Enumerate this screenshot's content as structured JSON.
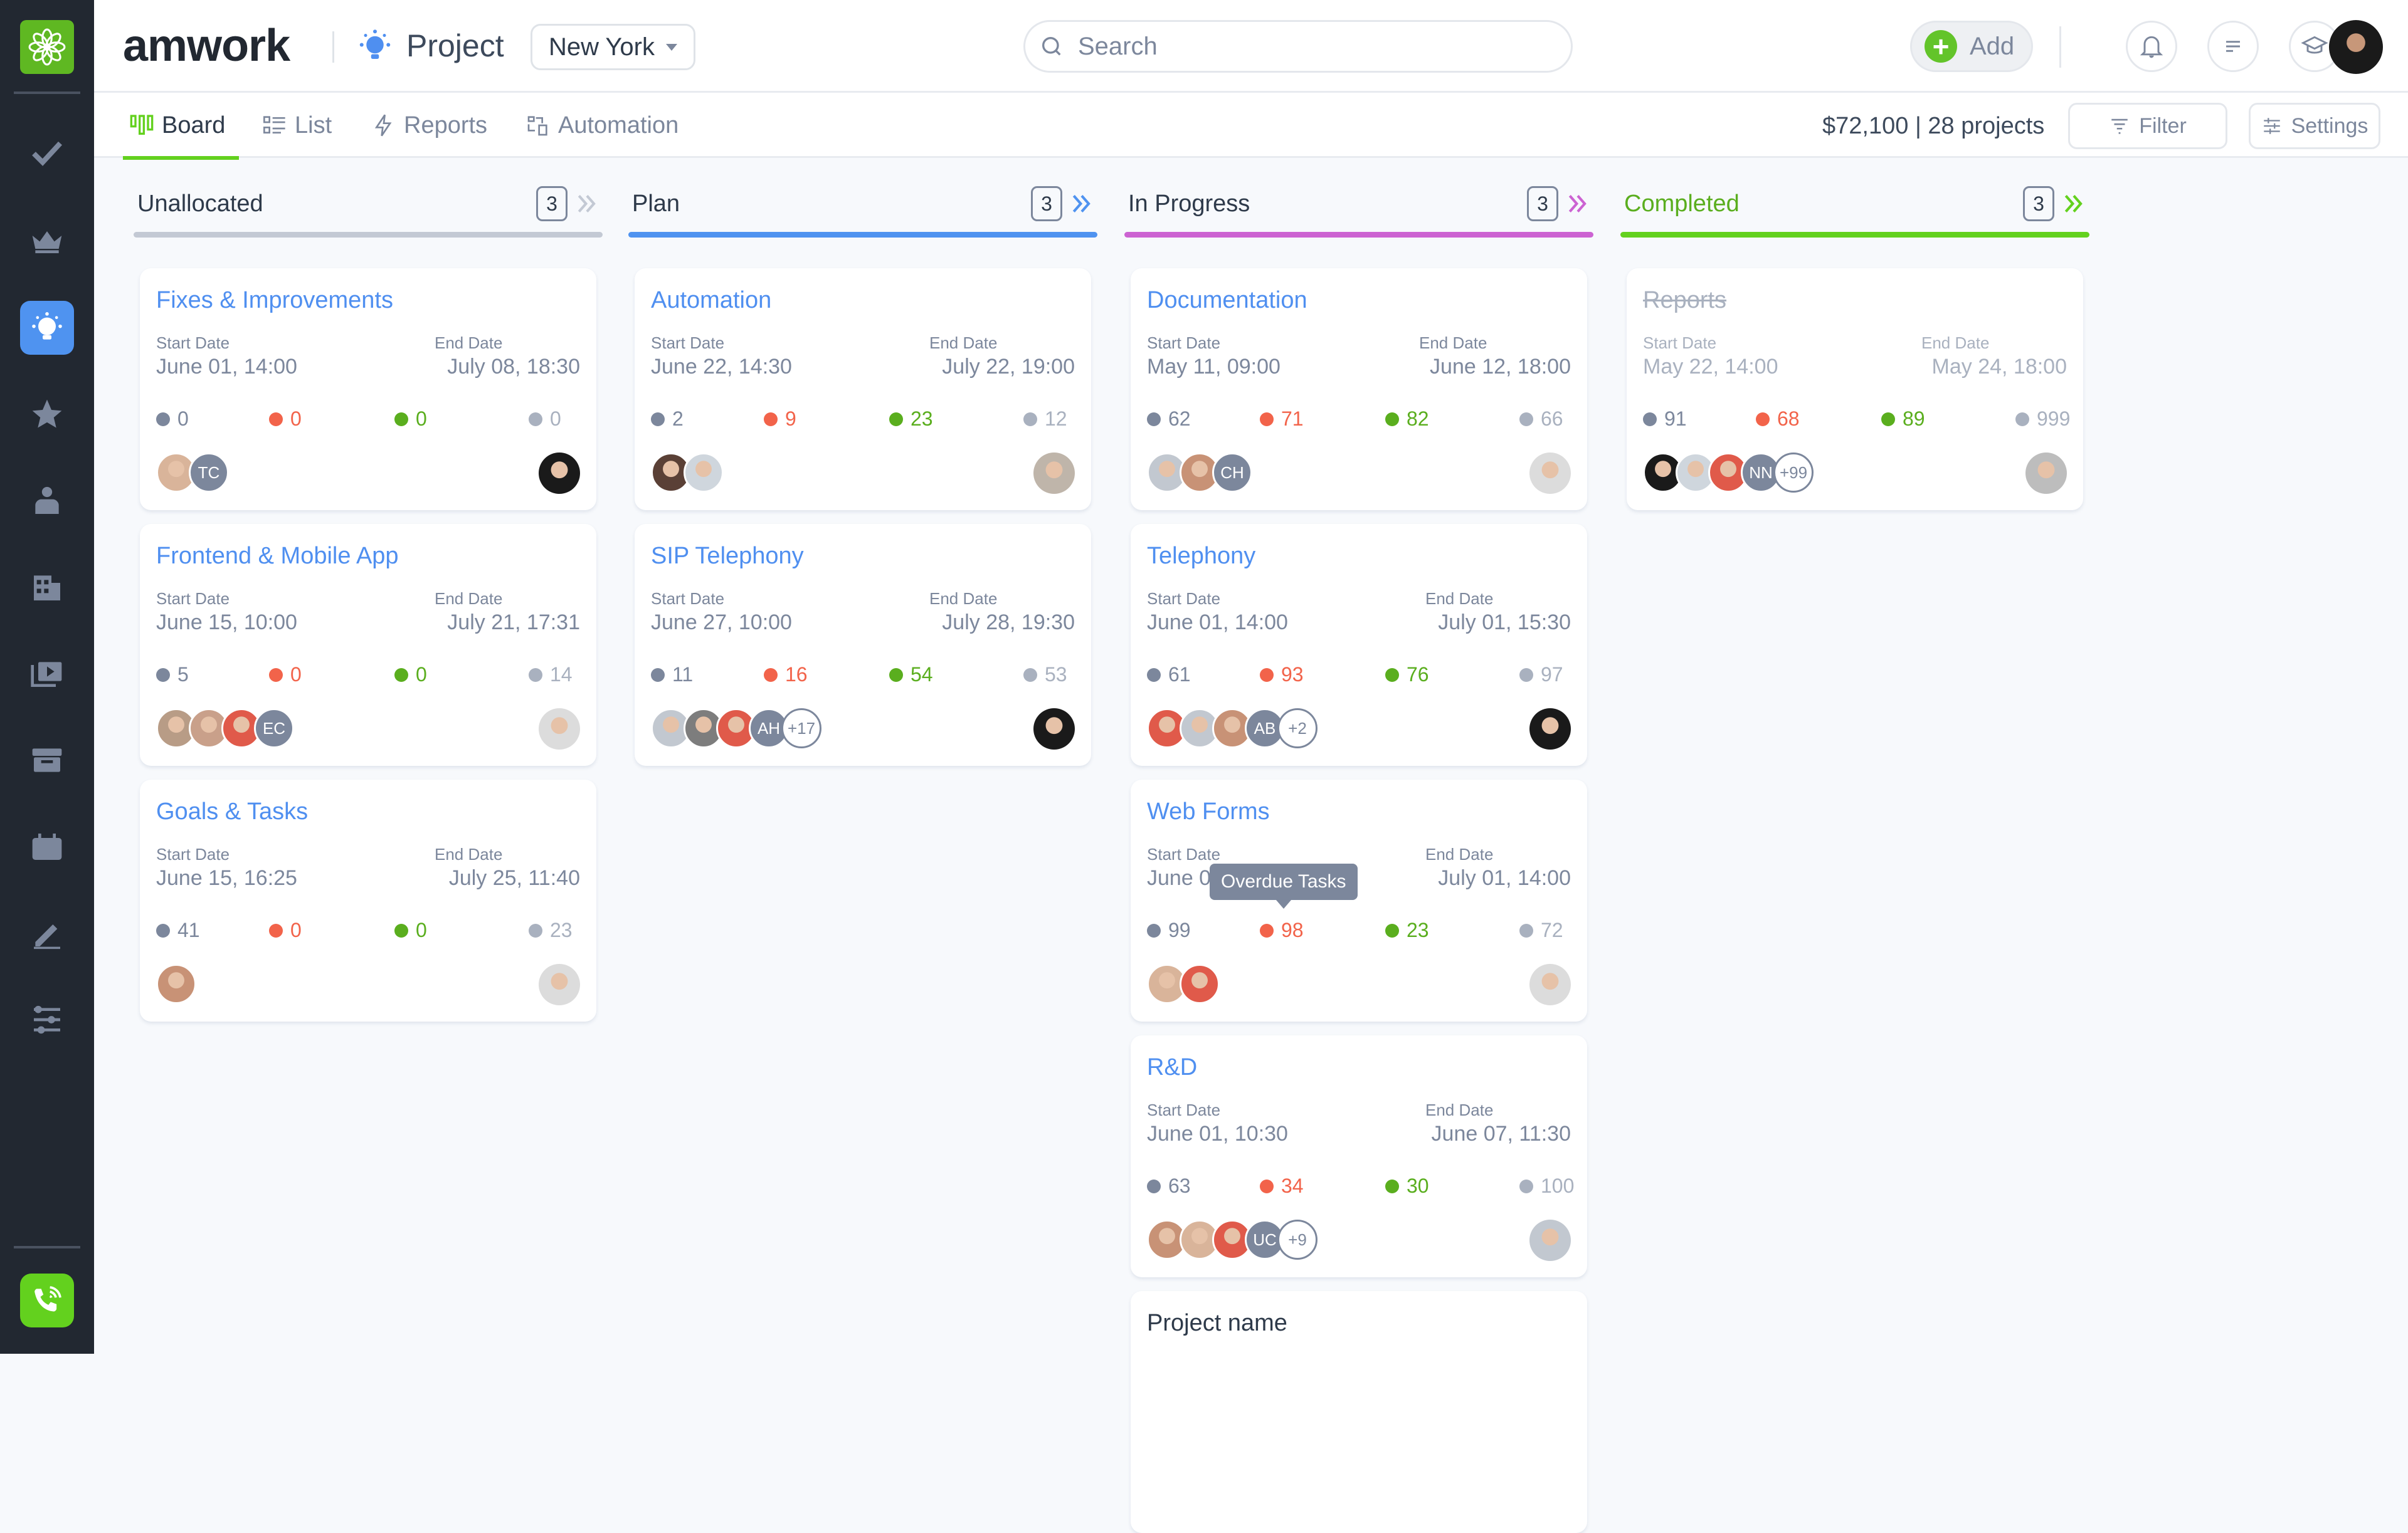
{
  "brand": {
    "name": "amwork"
  },
  "header": {
    "module_title": "Project",
    "city_select": "New York",
    "search_placeholder": "Search",
    "add_label": "Add"
  },
  "tabs": [
    {
      "label": "Board",
      "icon": "board-icon",
      "active": true
    },
    {
      "label": "List",
      "icon": "list-icon",
      "active": false
    },
    {
      "label": "Reports",
      "icon": "bolt-icon",
      "active": false
    },
    {
      "label": "Automation",
      "icon": "automation-icon",
      "active": false
    }
  ],
  "summary": {
    "amount": "$72,100",
    "separator": "|",
    "count": "28 projects"
  },
  "toolbar": {
    "filter_label": "Filter",
    "settings_label": "Settings"
  },
  "sidebar": {
    "items": [
      {
        "name": "tasks",
        "icon": "check-icon"
      },
      {
        "name": "crown",
        "icon": "crown-icon"
      },
      {
        "name": "projects",
        "icon": "lightbulb-icon",
        "active": true
      },
      {
        "name": "favorites",
        "icon": "star-icon"
      },
      {
        "name": "contacts",
        "icon": "person-icon"
      },
      {
        "name": "companies",
        "icon": "building-icon"
      },
      {
        "name": "media",
        "icon": "media-icon"
      },
      {
        "name": "archive",
        "icon": "archive-icon"
      },
      {
        "name": "calendar",
        "icon": "calendar-icon"
      },
      {
        "name": "notes",
        "icon": "pencil-icon"
      },
      {
        "name": "settings",
        "icon": "sliders-icon"
      }
    ]
  },
  "labels": {
    "start": "Start Date",
    "end": "End Date"
  },
  "colors": {
    "accent_blue": "#4f8ff0",
    "green": "#63d11e",
    "purple": "#cc63d2",
    "gray": "#c3c9d4",
    "stat_total": "#7c879c",
    "stat_overdue": "#f2634a",
    "stat_done": "#5aae1e",
    "stat_other": "#a9b1bf"
  },
  "columns": [
    {
      "title": "Unallocated",
      "count": "3",
      "color": "#c3c9d4",
      "title_color": "#2e3a4a",
      "cards": [
        {
          "title": "Fixes & Improvements",
          "start": "June 01, 14:00",
          "end": "July 08, 18:30",
          "stats": [
            "0",
            "0",
            "0",
            "0"
          ],
          "avatars": [
            {
              "type": "photo",
              "c": "#d9b49a"
            },
            {
              "type": "init",
              "text": "TC"
            }
          ],
          "owner": "#1a1a1a"
        },
        {
          "title": "Frontend & Mobile App",
          "start": "June 15, 10:00",
          "end": "July 21, 17:31",
          "stats": [
            "5",
            "0",
            "0",
            "14"
          ],
          "avatars": [
            {
              "type": "photo",
              "c": "#b89c86"
            },
            {
              "type": "photo",
              "c": "#c9a08a"
            },
            {
              "type": "photo",
              "c": "#e05a4a"
            },
            {
              "type": "init",
              "text": "EC"
            }
          ],
          "owner": "#dcdcdc"
        },
        {
          "title": "Goals & Tasks",
          "start": "June 15, 16:25",
          "end": "July 25, 11:40",
          "stats": [
            "41",
            "0",
            "0",
            "23"
          ],
          "avatars": [
            {
              "type": "photo",
              "c": "#c89276"
            }
          ],
          "owner": "#dcdcdc"
        }
      ]
    },
    {
      "title": "Plan",
      "count": "3",
      "color": "#4f93f0",
      "title_color": "#2e3a4a",
      "cards": [
        {
          "title": "Automation",
          "start": "June 22, 14:30",
          "end": "July 22, 19:00",
          "stats": [
            "2",
            "9",
            "23",
            "12"
          ],
          "avatars": [
            {
              "type": "photo",
              "c": "#5a4036"
            },
            {
              "type": "photo",
              "c": "#cfd6dd"
            }
          ],
          "owner": "#bfb5aa"
        },
        {
          "title": "SIP Telephony",
          "start": "June 27, 10:00",
          "end": "July 28, 19:30",
          "stats": [
            "11",
            "16",
            "54",
            "53"
          ],
          "avatars": [
            {
              "type": "photo",
              "c": "#c2c8d0"
            },
            {
              "type": "photo",
              "c": "#7d7d7d"
            },
            {
              "type": "photo",
              "c": "#e05a4a"
            },
            {
              "type": "init",
              "text": "AH"
            },
            {
              "type": "more",
              "text": "+17"
            }
          ],
          "owner": "#1a1a1a"
        }
      ]
    },
    {
      "title": "In Progress",
      "count": "3",
      "color": "#cc63d2",
      "title_color": "#2e3a4a",
      "cards": [
        {
          "title": "Documentation",
          "start": "May 11, 09:00",
          "end": "June 12, 18:00",
          "stats": [
            "62",
            "71",
            "82",
            "66"
          ],
          "avatars": [
            {
              "type": "photo",
              "c": "#c2c8d0"
            },
            {
              "type": "photo",
              "c": "#c89276"
            },
            {
              "type": "init",
              "text": "CH"
            }
          ],
          "owner": "#dcdcdc"
        },
        {
          "title": "Telephony",
          "start": "June 01, 14:00",
          "end": "July 01, 15:30",
          "stats": [
            "61",
            "93",
            "76",
            "97"
          ],
          "avatars": [
            {
              "type": "photo",
              "c": "#e05a4a"
            },
            {
              "type": "photo",
              "c": "#c2c8d0"
            },
            {
              "type": "photo",
              "c": "#c89276"
            },
            {
              "type": "init",
              "text": "AB"
            },
            {
              "type": "more",
              "text": "+2"
            }
          ],
          "owner": "#1a1a1a"
        },
        {
          "title": "Web Forms",
          "start": "June 01, 14:00",
          "end": "July 01, 14:00",
          "stats": [
            "99",
            "98",
            "23",
            "72"
          ],
          "avatars": [
            {
              "type": "photo",
              "c": "#d9b49a"
            },
            {
              "type": "photo",
              "c": "#e05a4a"
            }
          ],
          "owner": "#dcdcdc",
          "tooltip": "Overdue Tasks"
        },
        {
          "title": "R&D",
          "start": "June 01, 10:30",
          "end": "June 07, 11:30",
          "stats": [
            "63",
            "34",
            "30",
            "100"
          ],
          "avatars": [
            {
              "type": "photo",
              "c": "#c89276"
            },
            {
              "type": "photo",
              "c": "#d9b49a"
            },
            {
              "type": "photo",
              "c": "#e05a4a"
            },
            {
              "type": "init",
              "text": "UC"
            },
            {
              "type": "more",
              "text": "+9"
            }
          ],
          "owner": "#c2c8d0"
        },
        {
          "title": "Project name",
          "placeholder_card": true
        }
      ]
    },
    {
      "title": "Completed",
      "count": "3",
      "color": "#63d11e",
      "title_color": "#5aae1e",
      "cards": [
        {
          "title": "Reports",
          "done": true,
          "start": "May 22, 14:00",
          "end": "May 24, 18:00",
          "stats": [
            "91",
            "68",
            "89",
            "999"
          ],
          "avatars": [
            {
              "type": "photo",
              "c": "#1a1a1a"
            },
            {
              "type": "photo",
              "c": "#cfd6dd"
            },
            {
              "type": "photo",
              "c": "#e05a4a"
            },
            {
              "type": "init",
              "text": "NN"
            },
            {
              "type": "more",
              "text": "+99"
            }
          ],
          "owner": "#bdbdbd"
        }
      ]
    }
  ]
}
